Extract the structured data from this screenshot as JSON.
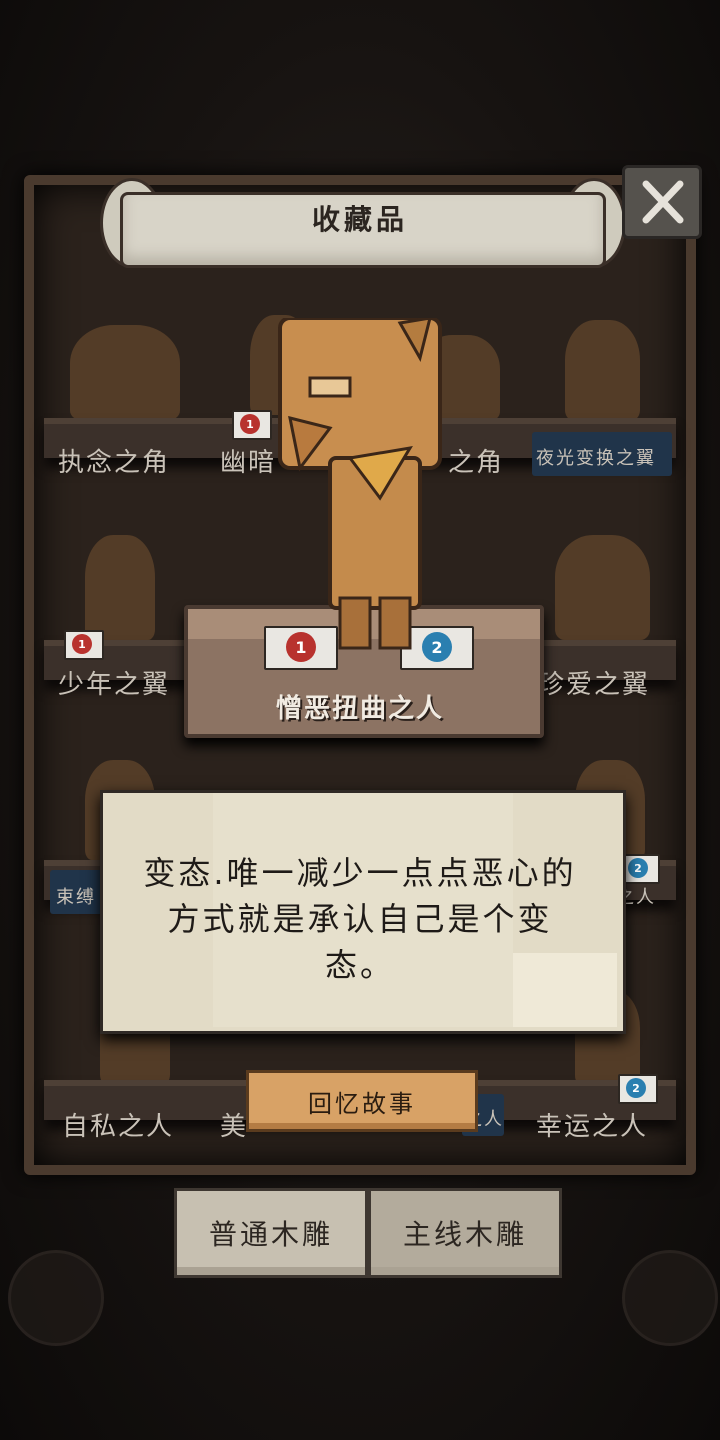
{
  "header": {
    "title": "收藏品"
  },
  "shelves": [
    {
      "items": [
        {
          "label": "执念之角"
        },
        {
          "label": "幽暗",
          "card": "1"
        },
        {
          "label": "之角"
        },
        {
          "label": "夜光变换之翼",
          "highlight": true
        }
      ]
    },
    {
      "items": [
        {
          "label": "少年之翼",
          "card": "1"
        },
        {
          "label": "珍爱之翼"
        }
      ]
    },
    {
      "items": [
        {
          "label": "束缚",
          "highlight": true
        },
        {
          "label": "之人",
          "card": "2"
        }
      ]
    },
    {
      "items": [
        {
          "label": "自私之人"
        },
        {
          "label": "美"
        },
        {
          "label": "之人",
          "highlight": true
        },
        {
          "label": "幸运之人",
          "card": "2"
        }
      ]
    }
  ],
  "featured": {
    "name": "憎恶扭曲之人",
    "cards": [
      {
        "number": "1",
        "color": "#b8322e"
      },
      {
        "number": "2",
        "color": "#2a7fb0"
      }
    ]
  },
  "dialog": {
    "text": "变态.唯一减少一点点恶心的方式就是承认自己是个变态。"
  },
  "actions": {
    "memory_label": "回忆故事"
  },
  "tabs": [
    {
      "label": "普通木雕"
    },
    {
      "label": "主线木雕"
    }
  ],
  "colors": {
    "wood": "#c48b4c",
    "paper": "#e2dbc6",
    "button": "#d8a266"
  }
}
